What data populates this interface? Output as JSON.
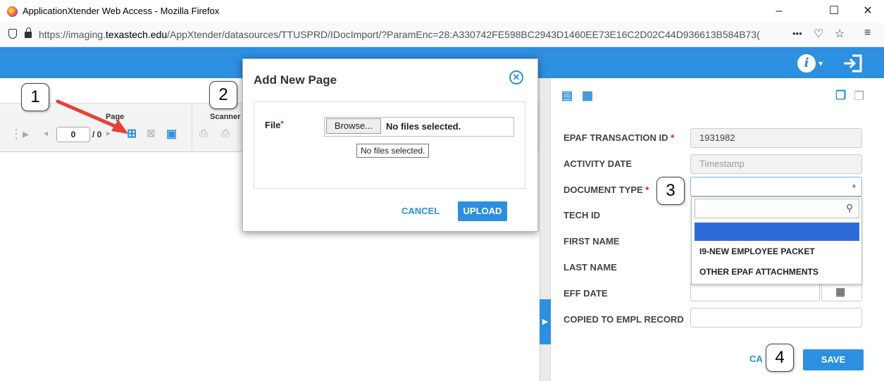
{
  "window": {
    "title": "ApplicationXtender Web Access - Mozilla Firefox",
    "minimize_glyph": "–",
    "maximize_glyph": "☐",
    "close_glyph": "✕"
  },
  "browser": {
    "url_prefix": "https://imaging.",
    "url_domain": "texastech.edu",
    "url_suffix": "/AppXtender/datasources/TTUSPRD/IDocImport/?ParamEnc=28:A330742FE598BC2943D1460EE73E16C2D02C44D936613B584B73(",
    "more_glyph": "•••",
    "pocket_glyph": "♡",
    "bookmark_glyph": "☆",
    "menu_glyph": "≡"
  },
  "toolbar": {
    "page_label": "Page",
    "scanner_label": "Scanner",
    "page_number": "0",
    "page_total": "/ 0"
  },
  "callouts": [
    "1",
    "2",
    "3",
    "4"
  ],
  "dialog": {
    "title": "Add New Page",
    "file_label": "File",
    "required_mark": "*",
    "browse_label": "Browse...",
    "file_status": "No files selected.",
    "tooltip": "No files selected.",
    "cancel_label": "CANCEL",
    "upload_label": "UPLOAD"
  },
  "form": {
    "fields": [
      {
        "label": "EPAF TRANSACTION ID",
        "required": true,
        "value": "1931982"
      },
      {
        "label": "ACTIVITY DATE",
        "required": false,
        "value": "Timestamp"
      },
      {
        "label": "DOCUMENT TYPE",
        "required": true,
        "value": ""
      },
      {
        "label": "TECH ID",
        "required": false,
        "value": ""
      },
      {
        "label": "FIRST NAME",
        "required": false,
        "value": ""
      },
      {
        "label": "LAST NAME",
        "required": false,
        "value": ""
      },
      {
        "label": "EFF DATE",
        "required": false,
        "value": ""
      },
      {
        "label": "COPIED TO EMPL RECORD",
        "required": false,
        "value": ""
      }
    ],
    "dropdown_options": [
      "",
      "I9-NEW EMPLOYEE PACKET",
      "OTHER EPAF ATTACHMENTS"
    ],
    "cancel_label": "CA",
    "save_label": "SAVE"
  },
  "colors": {
    "accent": "#2d8fe0",
    "selected_option": "#2d6bd8",
    "required": "#dd1122",
    "arrow": "#e8403a"
  }
}
